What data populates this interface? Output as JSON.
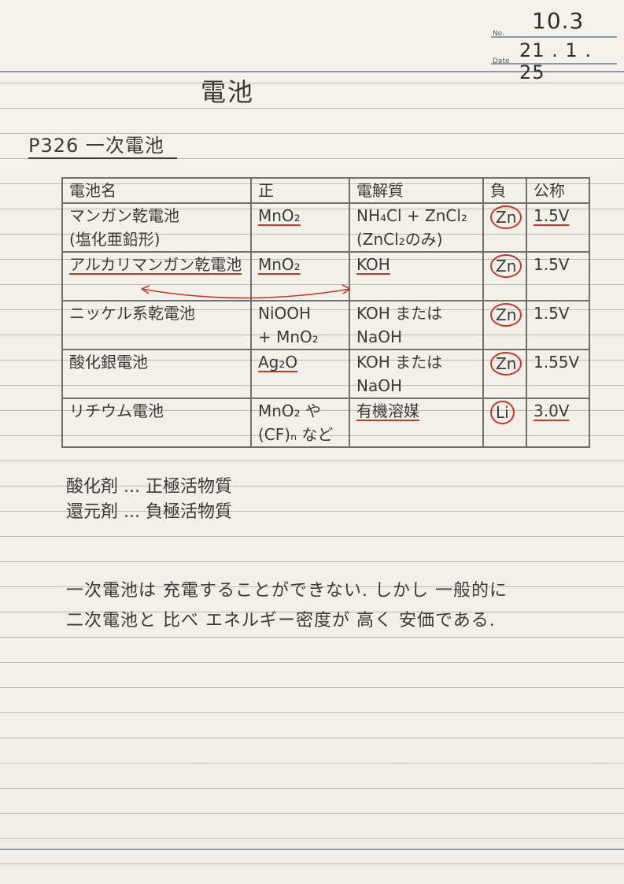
{
  "header": {
    "no_label": "No.",
    "no_value": "10.3",
    "date_label": "Date",
    "date_value": "21 . 1 . 25"
  },
  "title": "電池",
  "section_heading": "P326 一次電池",
  "table": {
    "headers": [
      "電池名",
      "正",
      "電解質",
      "負",
      "公称"
    ],
    "rows": [
      {
        "name": "マンガン乾電池",
        "name2": "(塩化亜鉛形)",
        "positive": "MnO₂",
        "positive2": "",
        "electrolyte": "NH₄Cl + ZnCl₂",
        "electrolyte2": "(ZnCl₂のみ)",
        "negative": "Zn",
        "voltage": "1.5V"
      },
      {
        "name": "アルカリマンガン乾電池",
        "name2": "",
        "positive": "MnO₂",
        "positive2": "",
        "electrolyte": "KOH",
        "electrolyte2": "",
        "negative": "Zn",
        "voltage": "1.5V"
      },
      {
        "name": "ニッケル系乾電池",
        "name2": "",
        "positive": "NiOOH",
        "positive2": "+ MnO₂",
        "electrolyte": "KOH または",
        "electrolyte2": "NaOH",
        "negative": "Zn",
        "voltage": "1.5V"
      },
      {
        "name": "酸化銀電池",
        "name2": "",
        "positive": "Ag₂O",
        "positive2": "",
        "electrolyte": "KOH または",
        "electrolyte2": "NaOH",
        "negative": "Zn",
        "voltage": "1.55V"
      },
      {
        "name": "リチウム電池",
        "name2": "",
        "positive": "MnO₂ や",
        "positive2": "(CF)ₙ など",
        "electrolyte": "有機溶媒",
        "electrolyte2": "",
        "negative": "Li",
        "voltage": "3.0V"
      }
    ]
  },
  "notes": {
    "line1": "酸化剤 ... 正極活物質",
    "line2": "還元剤 ... 負極活物質"
  },
  "summary": {
    "line1": "一次電池は 充電することができない. しかし 一般的に",
    "line2": "二次電池と 比べ エネルギー密度が 高く 安価である."
  },
  "colors": {
    "paper": "#f3f0ea",
    "rule": "#a9b3c4",
    "ink": "#3a3a3a",
    "accent_red": "#c0392b"
  }
}
